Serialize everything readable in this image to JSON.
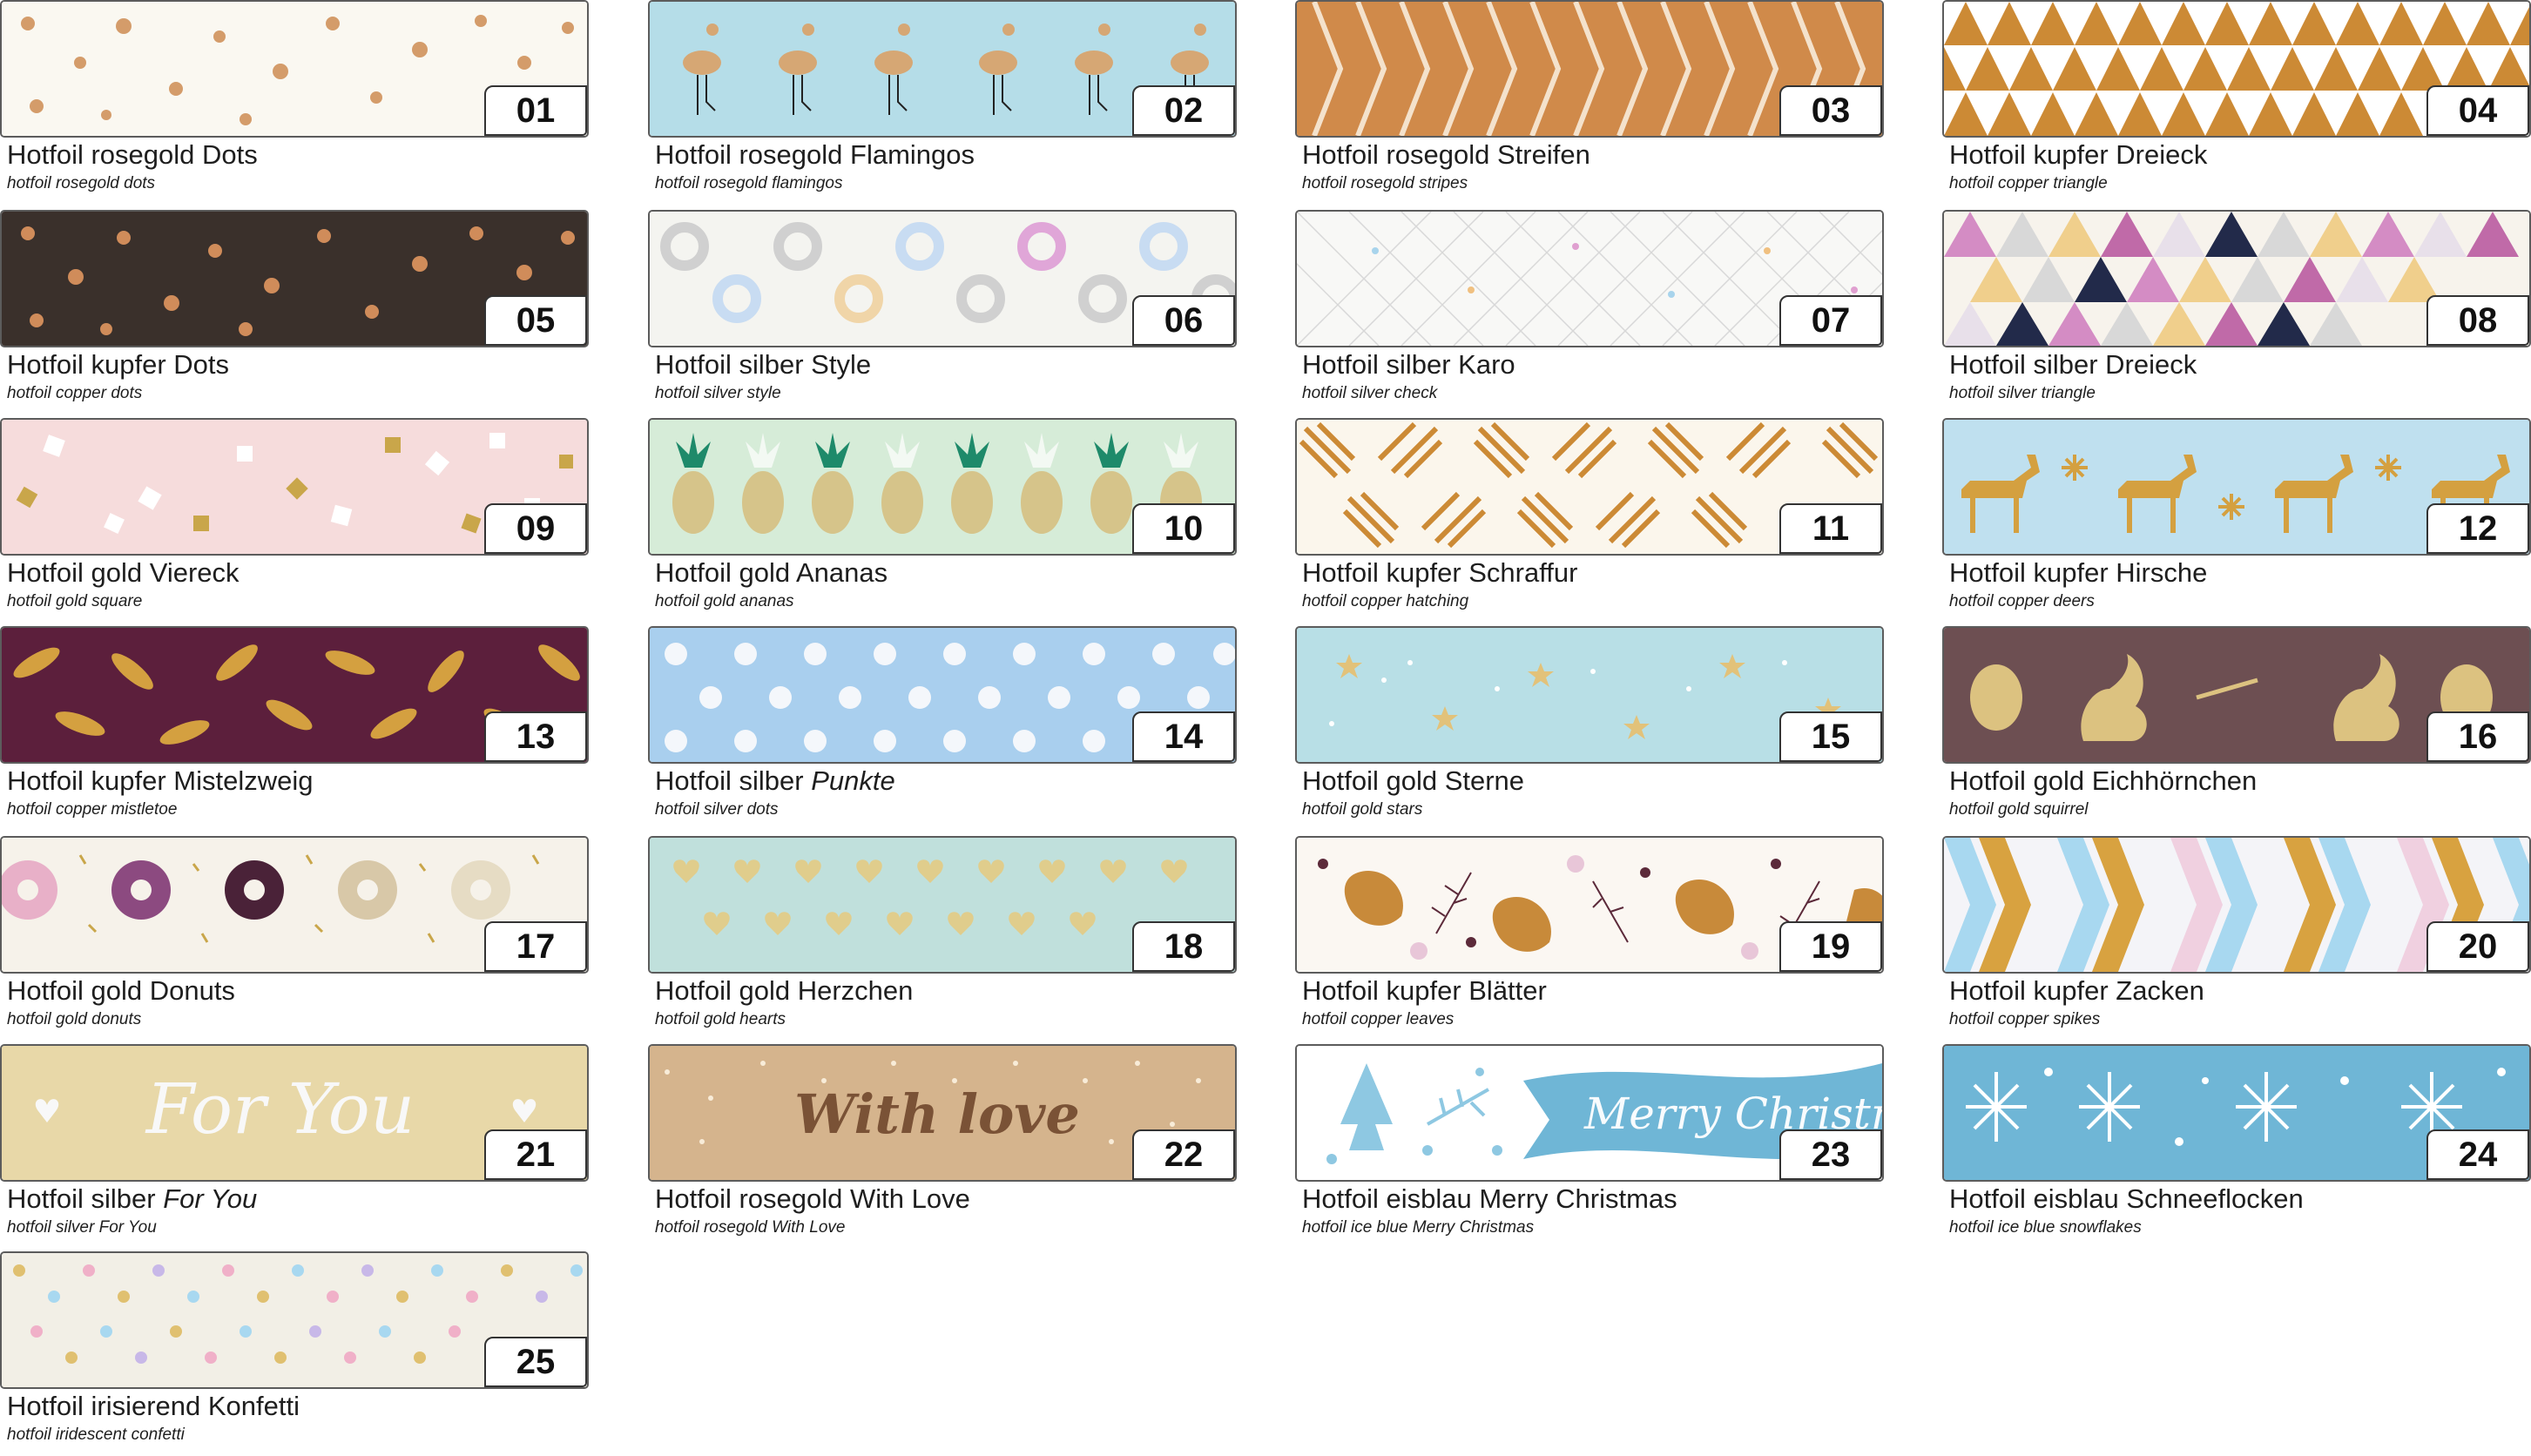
{
  "tapes": [
    {
      "number": "01",
      "name": "Hotfoil rosegold Dots",
      "subtitle": "hotfoil rosegold dots"
    },
    {
      "number": "02",
      "name": "Hotfoil rosegold Flamingos",
      "subtitle": "hotfoil rosegold flamingos"
    },
    {
      "number": "03",
      "name": "Hotfoil rosegold Streifen",
      "subtitle": "hotfoil rosegold stripes"
    },
    {
      "number": "04",
      "name": "Hotfoil kupfer Dreieck",
      "subtitle": "hotfoil copper triangle"
    },
    {
      "number": "05",
      "name": "Hotfoil kupfer Dots",
      "subtitle": "hotfoil copper dots"
    },
    {
      "number": "06",
      "name": "Hotfoil silber Style",
      "subtitle": "hotfoil silver style"
    },
    {
      "number": "07",
      "name": "Hotfoil silber Karo",
      "subtitle": "hotfoil silver check"
    },
    {
      "number": "08",
      "name": "Hotfoil silber Dreieck",
      "subtitle": "hotfoil silver triangle"
    },
    {
      "number": "09",
      "name": "Hotfoil gold Viereck",
      "subtitle": "hotfoil gold square"
    },
    {
      "number": "10",
      "name": "Hotfoil gold Ananas",
      "subtitle": "hotfoil gold ananas"
    },
    {
      "number": "11",
      "name": "Hotfoil kupfer Schraffur",
      "subtitle": "hotfoil copper hatching"
    },
    {
      "number": "12",
      "name": "Hotfoil kupfer Hirsche",
      "subtitle": "hotfoil copper deers"
    },
    {
      "number": "13",
      "name": "Hotfoil kupfer Mistelzweig",
      "subtitle": "hotfoil copper mistletoe"
    },
    {
      "number": "14",
      "name": "Hotfoil silber ",
      "name_italic": "Punkte",
      "subtitle": "hotfoil silver dots"
    },
    {
      "number": "15",
      "name": "Hotfoil gold Sterne",
      "subtitle": "hotfoil gold stars"
    },
    {
      "number": "16",
      "name": "Hotfoil gold Eichhörnchen",
      "subtitle": "hotfoil gold squirrel"
    },
    {
      "number": "17",
      "name": "Hotfoil gold Donuts",
      "subtitle": "hotfoil gold donuts"
    },
    {
      "number": "18",
      "name": "Hotfoil gold Herzchen",
      "subtitle": "hotfoil gold hearts"
    },
    {
      "number": "19",
      "name": "Hotfoil kupfer Blätter",
      "subtitle": "hotfoil copper leaves"
    },
    {
      "number": "20",
      "name": "Hotfoil kupfer Zacken",
      "subtitle": "hotfoil copper spikes"
    },
    {
      "number": "21",
      "name": "Hotfoil silber ",
      "name_italic": "For You",
      "subtitle": "hotfoil silver For You",
      "tape_text": "For You"
    },
    {
      "number": "22",
      "name": "Hotfoil rosegold With Love",
      "subtitle": "hotfoil rosegold With Love",
      "tape_text": "With love"
    },
    {
      "number": "23",
      "name": "Hotfoil eisblau Merry Christmas",
      "subtitle": "hotfoil ice blue Merry Christmas",
      "tape_text": "Merry Christm"
    },
    {
      "number": "24",
      "name": "Hotfoil eisblau Schneeflocken",
      "subtitle": "hotfoil ice blue snowflakes"
    },
    {
      "number": "25",
      "name": "Hotfoil irisierend Konfetti",
      "subtitle": "hotfoil iridescent confetti"
    }
  ],
  "colors": {
    "rosegold": "#d4a070",
    "copper": "#c8862e",
    "gold": "#c9a64a",
    "silver": "#d6d6d6",
    "ice_blue": "#6fb6d6",
    "cream": "#fbf9f2",
    "dark_brown": "#3b302a",
    "plum": "#5c1f3c",
    "baby_blue": "#a9cfee",
    "mint": "#b8dcdc",
    "kraft": "#d5b48d",
    "sand": "#e8d8a8",
    "blush": "#f6dcdc",
    "mauve": "#6d4f52"
  }
}
